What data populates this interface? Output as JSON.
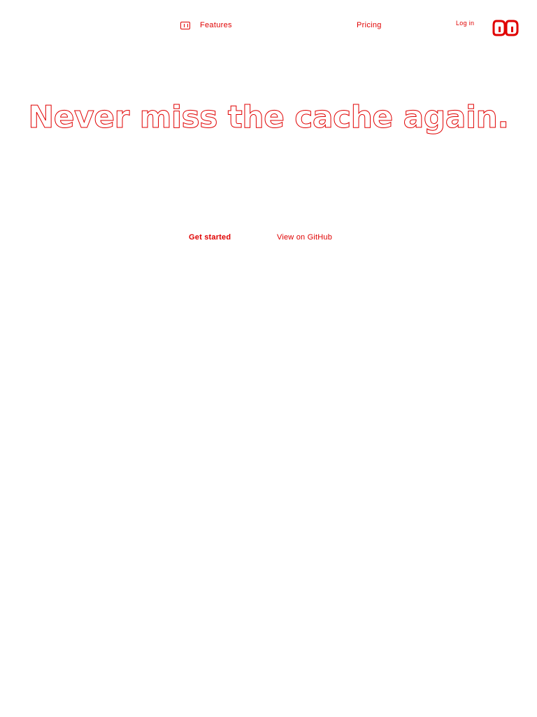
{
  "nav": {
    "features_label": "Features",
    "pricing_label": "Pricing",
    "login_label": "Log in",
    "icons": {
      "features": "grid-icon",
      "logo": "brand-logo-icon"
    }
  },
  "hero": {
    "title": "Never miss the cache again.",
    "primary_cta": "Get started",
    "secondary_cta": "View on GitHub"
  },
  "colors": {
    "accent": "#e00000",
    "background": "#ffffff"
  }
}
